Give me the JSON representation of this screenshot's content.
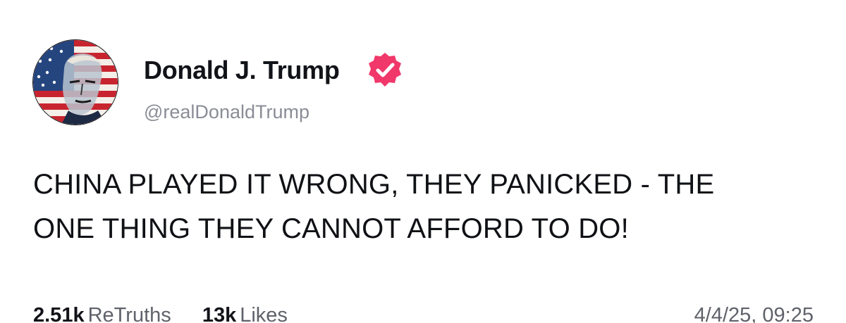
{
  "post": {
    "author": {
      "display_name": "Donald J. Trump",
      "handle": "@realDonaldTrump",
      "avatar_icon": "flag-portrait-avatar",
      "verified_icon": "verified-badge-icon",
      "verified_color": "#f0386b"
    },
    "body_lines": [
      "CHINA PLAYED IT WRONG, THEY PANICKED - THE",
      "ONE THING THEY CANNOT AFFORD TO DO!"
    ],
    "stats": {
      "retruths_count": "2.51k",
      "retruths_label": "ReTruths",
      "likes_count": "13k",
      "likes_label": "Likes"
    },
    "timestamp": "4/4/25, 09:25"
  }
}
